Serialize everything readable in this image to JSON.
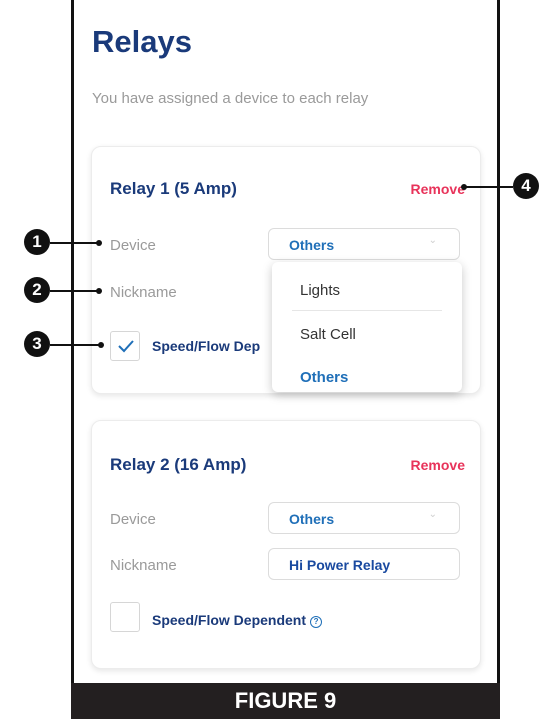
{
  "page": {
    "title": "Relays",
    "subtitle": "You have assigned a device to each relay"
  },
  "relays": [
    {
      "title": "Relay 1 (5 Amp)",
      "remove_label": "Remove",
      "device_label": "Device",
      "device_value": "Others",
      "nickname_label": "Nickname",
      "checkbox_checked": true,
      "checkbox_label": "Speed/Flow Dep"
    },
    {
      "title": "Relay 2 (16 Amp)",
      "remove_label": "Remove",
      "device_label": "Device",
      "device_value": "Others",
      "nickname_label": "Nickname",
      "nickname_value": "Hi Power Relay",
      "checkbox_checked": false,
      "checkbox_label": "Speed/Flow Dependent"
    }
  ],
  "device_dropdown": {
    "options": [
      "Lights",
      "Salt Cell",
      "Others"
    ],
    "selected": "Others"
  },
  "callouts": [
    "1",
    "2",
    "3",
    "4"
  ],
  "figure_caption": "FIGURE 9",
  "icons": {
    "checkmark": "check-icon",
    "help": "help-circle-icon",
    "chevron": "chevron-down-icon"
  },
  "colors": {
    "title": "#1a3a7a",
    "accent": "#1f6fb8",
    "remove": "#e8335a"
  }
}
